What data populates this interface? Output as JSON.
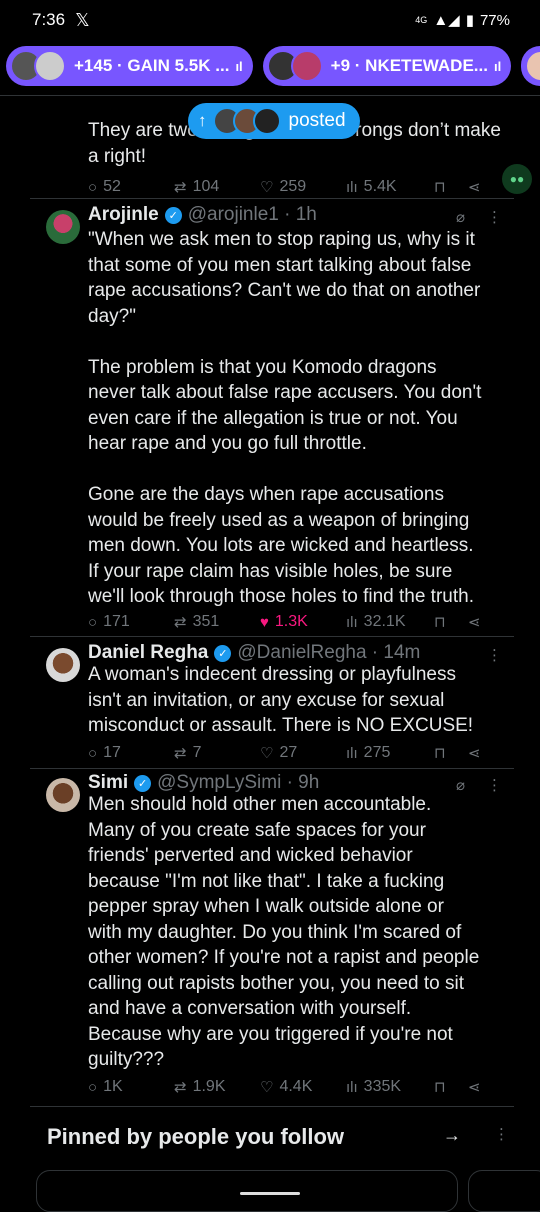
{
  "status_bar": {
    "time": "7:36",
    "x_logo": "𝕏",
    "battery": "77%",
    "network": "4G"
  },
  "spaces": [
    {
      "text": "+145 · GAIN 5.5K ...",
      "bars": "ıl"
    },
    {
      "text": "+9 · NKETEWADE...",
      "bars": "ıl"
    }
  ],
  "posted_pill": {
    "arrow": "↑",
    "label": "posted"
  },
  "partial_tweet": {
    "text": "They are two wrongs and two wrongs don’t make\na right!",
    "replies": "52",
    "reposts": "104",
    "likes": "259",
    "views": "5.4K"
  },
  "tweets": [
    {
      "name": "Arojinle",
      "handle": "@arojinle1 · 1h",
      "text": "\"When we ask men to stop raping us, why is it\nthat some of you men start talking about false\nrape accusations? Can't we do that on another\nday?\"\n\nThe problem is that  you Komodo dragons\nnever talk about false rape accusers. You don't\neven care if the allegation is true or not. You\nhear rape and you go full throttle.\n\nGone are the days when rape accusations\nwould be freely used as a weapon of bringing\nmen down. You lots are wicked and heartless.\nIf your rape claim has visible holes, be sure\nwe'll look through those holes to find the truth.",
      "replies": "171",
      "reposts": "351",
      "likes": "1.3K",
      "views": "32.1K"
    },
    {
      "name": "Daniel Regha",
      "handle": "@DanielRegha · 14m",
      "text": "A woman's indecent dressing or playfulness\nisn't an invitation, or any excuse for sexual\nmisconduct or assault. There is NO EXCUSE!",
      "replies": "17",
      "reposts": "7",
      "likes": "27",
      "views": "275"
    },
    {
      "name": "Simi",
      "handle": "@SympLySimi · 9h",
      "text": "Men should hold other men accountable.\nMany of you create safe spaces for your\nfriends' perverted and wicked behavior\nbecause \"I'm not like that\". I take a fucking\npepper spray when I walk outside alone or\nwith my daughter. Do you think I'm scared of\nother women? If you're not a rapist and people\ncalling out rapists bother you, you need to sit\nand have a conversation with yourself.\nBecause why are you triggered if you're not\nguilty???",
      "replies": "1K",
      "reposts": "1.9K",
      "likes": "4.4K",
      "views": "335K"
    }
  ],
  "pinned": {
    "title": "Pinned by people you follow",
    "arrow": "→"
  },
  "icons": {
    "reply": "○",
    "repost": "⇄",
    "like": "♡",
    "liked": "♥",
    "views": "ılı",
    "bookmark": "⊓",
    "share": "⋖",
    "grok": "⌀",
    "more": "⋮",
    "verified": "✓"
  },
  "colors": {
    "accent": "#1d9bf0",
    "spaces": "#7856ff",
    "like": "#f91880"
  }
}
